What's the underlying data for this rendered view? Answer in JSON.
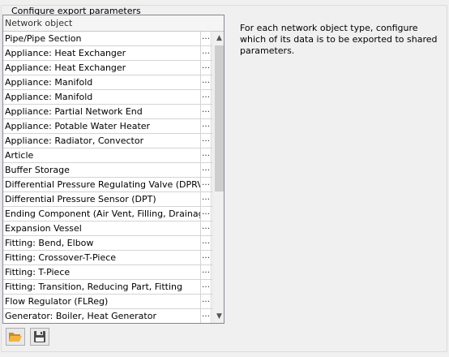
{
  "group_title": "Configure export parameters",
  "grid": {
    "header": "Network object",
    "button_glyph": "…",
    "rows": [
      "Pipe/Pipe Section",
      "Appliance: Heat Exchanger",
      "Appliance: Heat Exchanger",
      "Appliance: Manifold",
      "Appliance: Manifold",
      "Appliance: Partial Network End",
      "Appliance: Potable Water Heater",
      "Appliance: Radiator, Convector",
      "Article",
      "Buffer Storage",
      "Differential Pressure Regulating Valve (DPRV)",
      "Differential Pressure Sensor (DPT)",
      "Ending Component (Air Vent, Filling, Drainage)",
      "Expansion Vessel",
      "Fitting: Bend, Elbow",
      "Fitting: Crossover-T-Piece",
      "Fitting: T-Piece",
      "Fitting: Transition, Reducing Part, Fitting",
      "Flow Regulator (FLReg)",
      "Generator: Boiler, Heat Generator"
    ],
    "scroll_up_glyph": "▲",
    "scroll_down_glyph": "▼"
  },
  "description": "For each network object type, configure which of its data is to be exported to shared parameters.",
  "toolbar": {
    "open_icon": "folder-open-icon",
    "save_icon": "floppy-disk-icon",
    "folder_color": "#e8a33a",
    "save_color": "#4a4a4a"
  }
}
